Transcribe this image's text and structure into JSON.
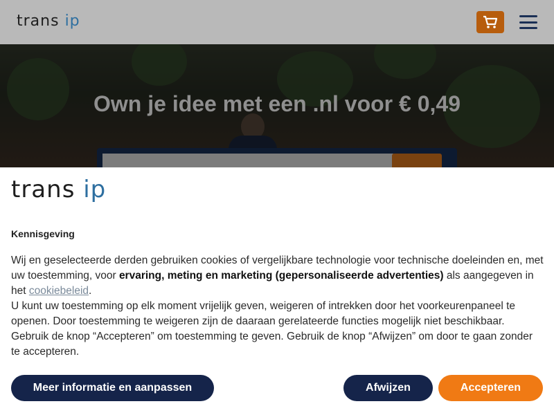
{
  "header": {
    "logo_left": "trans",
    "logo_right": "ip",
    "cart_icon": "cart-icon",
    "menu_icon": "hamburger-menu-icon"
  },
  "hero": {
    "title": "Own je idee met een .nl voor € 0,49"
  },
  "cookie_banner": {
    "logo_left": "trans",
    "logo_right": "ip",
    "title": "Kennisgeving",
    "text_1": "Wij en geselecteerde derden gebruiken cookies of vergelijkbare technologie voor technische doeleinden en, met uw toestemming, voor ",
    "text_bold": "ervaring, meting en marketing (gepersonaliseerde advertenties)",
    "text_2": " als aangegeven in het ",
    "link_text": "cookiebeleid",
    "text_3": ".",
    "text_4": "U kunt uw toestemming op elk moment vrijelijk geven, weigeren of intrekken door het voorkeurenpaneel te openen. Door toestemming te weigeren zijn de daaraan gerelateerde functies mogelijk niet beschikbaar.",
    "text_5": "Gebruik de knop “Accepteren” om toestemming te geven. Gebruik de knop “Afwijzen” om door te gaan zonder te accepteren.",
    "btn_more": "Meer informatie en aanpassen",
    "btn_reject": "Afwijzen",
    "btn_accept": "Accepteren"
  },
  "colors": {
    "accent_orange": "#f07a14",
    "navy": "#15244a",
    "logo_blue": "#2e6fa0"
  }
}
